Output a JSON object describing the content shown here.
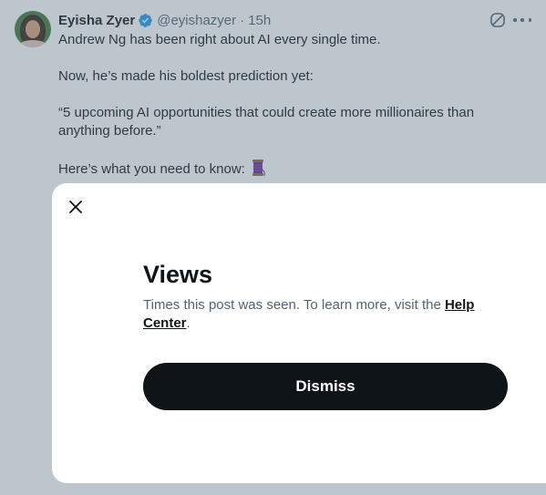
{
  "tweet": {
    "author": {
      "display_name": "Eyisha Zyer",
      "handle": "@eyishazyer",
      "separator": "·",
      "timestamp": "15h",
      "verified": true
    },
    "text": {
      "line1": "Andrew Ng has been right about AI every single time.",
      "line2": "Now, he’s made his boldest prediction yet:",
      "line3": "“5 upcoming AI opportunities that could create more millionaires than anything before.”",
      "line4": "Here’s what you need to know:"
    },
    "icons": {
      "grok": "grok-icon",
      "more": "more-options-icon",
      "emoji": "spool-of-thread-icon"
    }
  },
  "modal": {
    "title": "Views",
    "description_prefix": "Times this post was seen. To learn more, visit the ",
    "help_link": "Help Center",
    "description_suffix": ".",
    "dismiss_label": "Dismiss",
    "close_icon": "close-icon"
  },
  "colors": {
    "text_primary": "#0f1419",
    "text_secondary": "#536471",
    "verified_blue": "#1d9bf0",
    "button_bg": "#0f1419",
    "overlay": "rgba(91,112,131,0.4)"
  }
}
